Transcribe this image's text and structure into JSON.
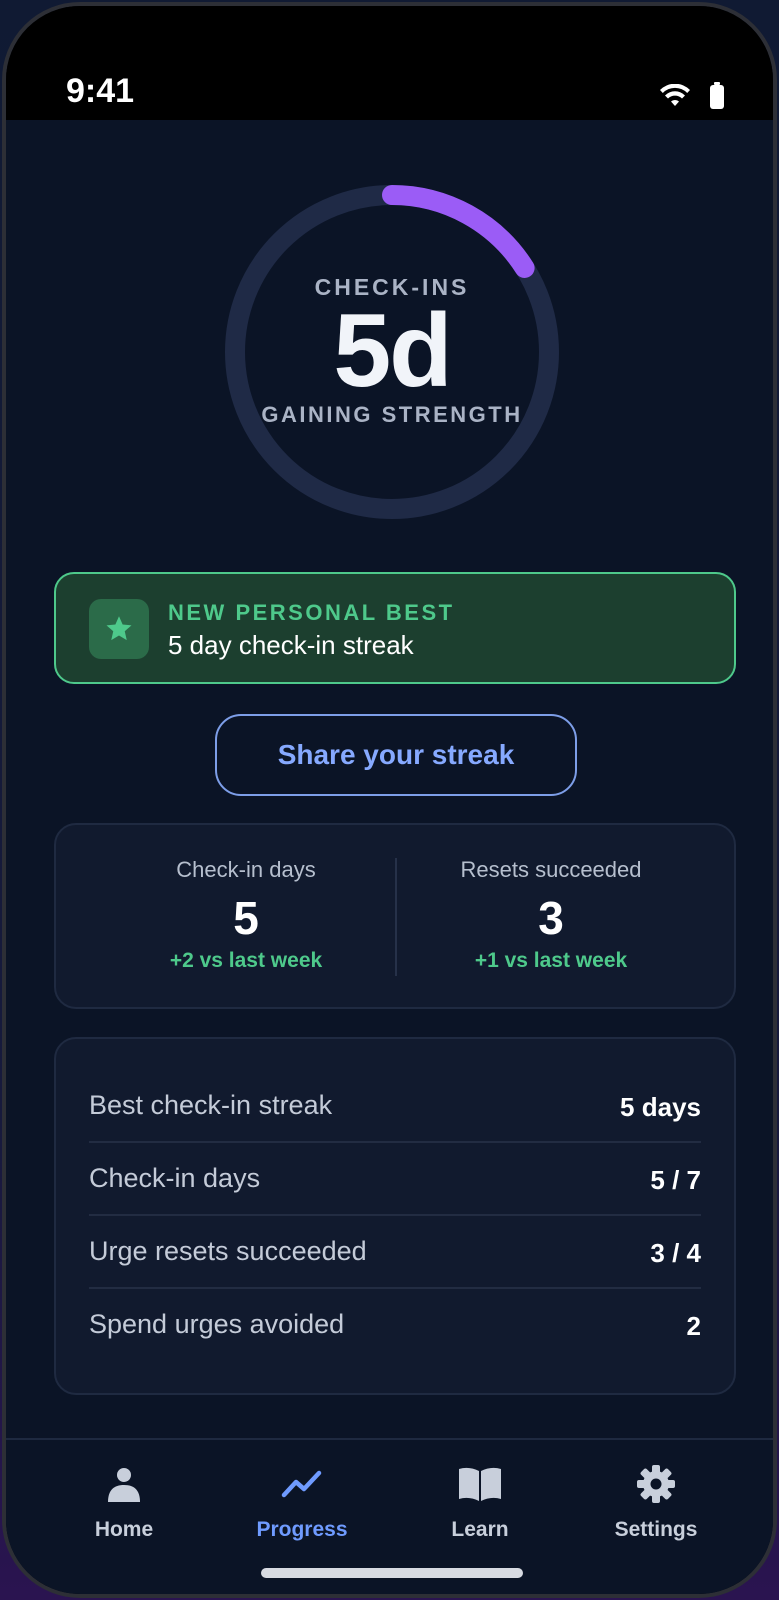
{
  "status": {
    "time": "9:41",
    "icons": [
      "wifi-icon",
      "battery-icon"
    ]
  },
  "ring": {
    "label": "CHECK-INS",
    "value": "5d",
    "subtitle": "GAINING STRENGTH",
    "progress_fraction": 0.16,
    "track_color": "#1f2a46",
    "progress_color": "#9b5cf6"
  },
  "banner": {
    "title": "NEW PERSONAL BEST",
    "subtitle": "5 day check-in streak",
    "icon": "star-icon",
    "accent": "#4ec98b"
  },
  "share_button": {
    "label": "Share your streak"
  },
  "stats": [
    {
      "label": "Check-in days",
      "value": "5",
      "delta": "+2 vs last week"
    },
    {
      "label": "Resets succeeded",
      "value": "3",
      "delta": "+1 vs last week"
    }
  ],
  "details": [
    {
      "label": "Best check-in streak",
      "value": "5 days"
    },
    {
      "label": "Check-in days",
      "value": "5 / 7"
    },
    {
      "label": "Urge resets succeeded",
      "value": "3 / 4"
    },
    {
      "label": "Spend urges avoided",
      "value": "2"
    }
  ],
  "nav": {
    "active": "Progress",
    "items": [
      {
        "label": "Home",
        "icon": "person-icon"
      },
      {
        "label": "Progress",
        "icon": "trend-icon"
      },
      {
        "label": "Learn",
        "icon": "book-icon"
      },
      {
        "label": "Settings",
        "icon": "gear-icon"
      }
    ]
  }
}
